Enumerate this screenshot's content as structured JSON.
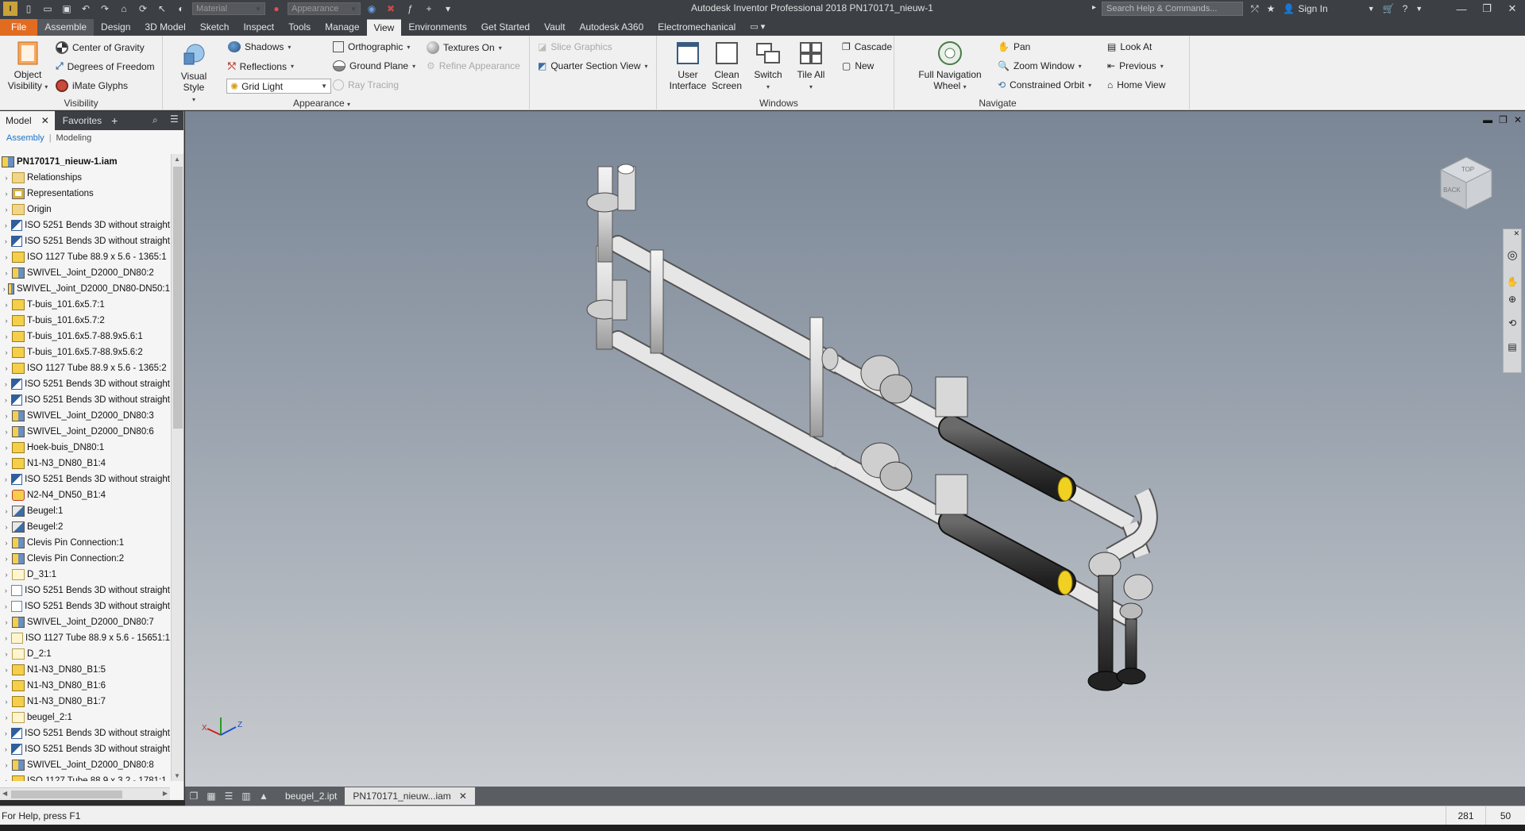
{
  "app": {
    "title": "Autodesk Inventor Professional 2018   PN170171_nieuw-1",
    "search_placeholder": "Search Help & Commands...",
    "sign_in": "Sign In",
    "material_combo": "Material",
    "appearance_combo": "Appearance"
  },
  "tabs": [
    "File",
    "Assemble",
    "Design",
    "3D Model",
    "Sketch",
    "Inspect",
    "Tools",
    "Manage",
    "View",
    "Environments",
    "Get Started",
    "Vault",
    "Autodesk A360",
    "Electromechanical"
  ],
  "active_tab": "View",
  "ribbon": {
    "visibility": {
      "title": "Visibility",
      "object_visibility": [
        "Object",
        "Visibility"
      ],
      "center_of_gravity": "Center of Gravity",
      "degrees_of_freedom": "Degrees of Freedom",
      "imate_glyphs": "iMate Glyphs"
    },
    "appearance": {
      "title": "Appearance",
      "visual_style": "Visual Style",
      "shadows": "Shadows",
      "reflections": "Reflections",
      "grid_light": "Grid Light",
      "orthographic": "Orthographic",
      "ground_plane": "Ground Plane",
      "ray_tracing": "Ray Tracing",
      "textures_on": "Textures On",
      "refine_appearance": "Refine Appearance",
      "slice_graphics": "Slice Graphics",
      "quarter_section_view": "Quarter Section View"
    },
    "windows": {
      "title": "Windows",
      "user_interface": [
        "User",
        "Interface"
      ],
      "clean_screen": [
        "Clean",
        "Screen"
      ],
      "switch": "Switch",
      "tile_all": "Tile All",
      "cascade": "Cascade",
      "new": "New"
    },
    "navigate": {
      "title": "Navigate",
      "full_nav_wheel": [
        "Full Navigation",
        "Wheel"
      ],
      "pan": "Pan",
      "zoom_window": "Zoom Window",
      "constrained_orbit": "Constrained Orbit",
      "look_at": "Look At",
      "previous": "Previous",
      "home_view": "Home View"
    }
  },
  "browser": {
    "tab_model": "Model",
    "tab_favorites": "Favorites",
    "sub_assembly": "Assembly",
    "sub_modeling": "Modeling",
    "root": "PN170171_nieuw-1.iam",
    "items": [
      {
        "label": "Relationships",
        "icon": "folder"
      },
      {
        "label": "Representations",
        "icon": "representations"
      },
      {
        "label": "Origin",
        "icon": "folder"
      },
      {
        "label": "ISO 5251 Bends 3D without straight",
        "icon": "bend"
      },
      {
        "label": "ISO 5251 Bends 3D without straight",
        "icon": "bend"
      },
      {
        "label": "ISO 1127 Tube 88.9 x 5.6 - 1365:1",
        "icon": "part"
      },
      {
        "label": "SWIVEL_Joint_D2000_DN80:2",
        "icon": "assembly"
      },
      {
        "label": "SWIVEL_Joint_D2000_DN80-DN50:1",
        "icon": "assembly"
      },
      {
        "label": "T-buis_101.6x5.7:1",
        "icon": "part"
      },
      {
        "label": "T-buis_101.6x5.7:2",
        "icon": "part"
      },
      {
        "label": "T-buis_101.6x5.7-88.9x5.6:1",
        "icon": "part"
      },
      {
        "label": "T-buis_101.6x5.7-88.9x5.6:2",
        "icon": "part"
      },
      {
        "label": "ISO 1127 Tube 88.9 x 5.6 - 1365:2",
        "icon": "part"
      },
      {
        "label": "ISO 5251 Bends 3D without straight",
        "icon": "bend"
      },
      {
        "label": "ISO 5251 Bends 3D without straight",
        "icon": "bend"
      },
      {
        "label": "SWIVEL_Joint_D2000_DN80:3",
        "icon": "assembly"
      },
      {
        "label": "SWIVEL_Joint_D2000_DN80:6",
        "icon": "assembly"
      },
      {
        "label": "Hoek-buis_DN80:1",
        "icon": "part"
      },
      {
        "label": "N1-N3_DN80_B1:4",
        "icon": "part"
      },
      {
        "label": "ISO 5251 Bends 3D without straight",
        "icon": "bend"
      },
      {
        "label": "N2-N4_DN50_B1:4",
        "icon": "part-rotate"
      },
      {
        "label": "Beugel:1",
        "icon": "beugel"
      },
      {
        "label": "Beugel:2",
        "icon": "beugel"
      },
      {
        "label": "Clevis Pin Connection:1",
        "icon": "assembly"
      },
      {
        "label": "Clevis Pin Connection:2",
        "icon": "assembly"
      },
      {
        "label": "D_31:1",
        "icon": "part-light"
      },
      {
        "label": "ISO 5251 Bends 3D without straight",
        "icon": "bend-light"
      },
      {
        "label": "ISO 5251 Bends 3D without straight",
        "icon": "bend-light"
      },
      {
        "label": "SWIVEL_Joint_D2000_DN80:7",
        "icon": "assembly"
      },
      {
        "label": "ISO 1127 Tube 88.9 x 5.6 - 15651:1",
        "icon": "part-light"
      },
      {
        "label": "D_2:1",
        "icon": "part-light"
      },
      {
        "label": "N1-N3_DN80_B1:5",
        "icon": "part"
      },
      {
        "label": "N1-N3_DN80_B1:6",
        "icon": "part"
      },
      {
        "label": "N1-N3_DN80_B1:7",
        "icon": "part"
      },
      {
        "label": "beugel_2:1",
        "icon": "part-light"
      },
      {
        "label": "ISO 5251 Bends 3D without straight",
        "icon": "bend"
      },
      {
        "label": "ISO 5251 Bends 3D without straight",
        "icon": "bend"
      },
      {
        "label": "SWIVEL_Joint_D2000_DN80:8",
        "icon": "assembly"
      },
      {
        "label": "ISO 1127 Tube 88.9 x 3.2 - 1781:1",
        "icon": "part"
      }
    ]
  },
  "viewcube": {
    "label": "BACK",
    "top_label": "TOP"
  },
  "document_tabs": [
    {
      "label": "beugel_2.ipt",
      "active": false
    },
    {
      "label": "PN170171_nieuw...iam",
      "active": true
    }
  ],
  "status": {
    "help": "For Help, press F1",
    "count1": "281",
    "count2": "50"
  },
  "colors": {
    "file_tab": "#e16c21",
    "titlebar": "#3c3f44",
    "ribbon": "#f0f0f0",
    "highlight_yellow": "#f0d020"
  }
}
